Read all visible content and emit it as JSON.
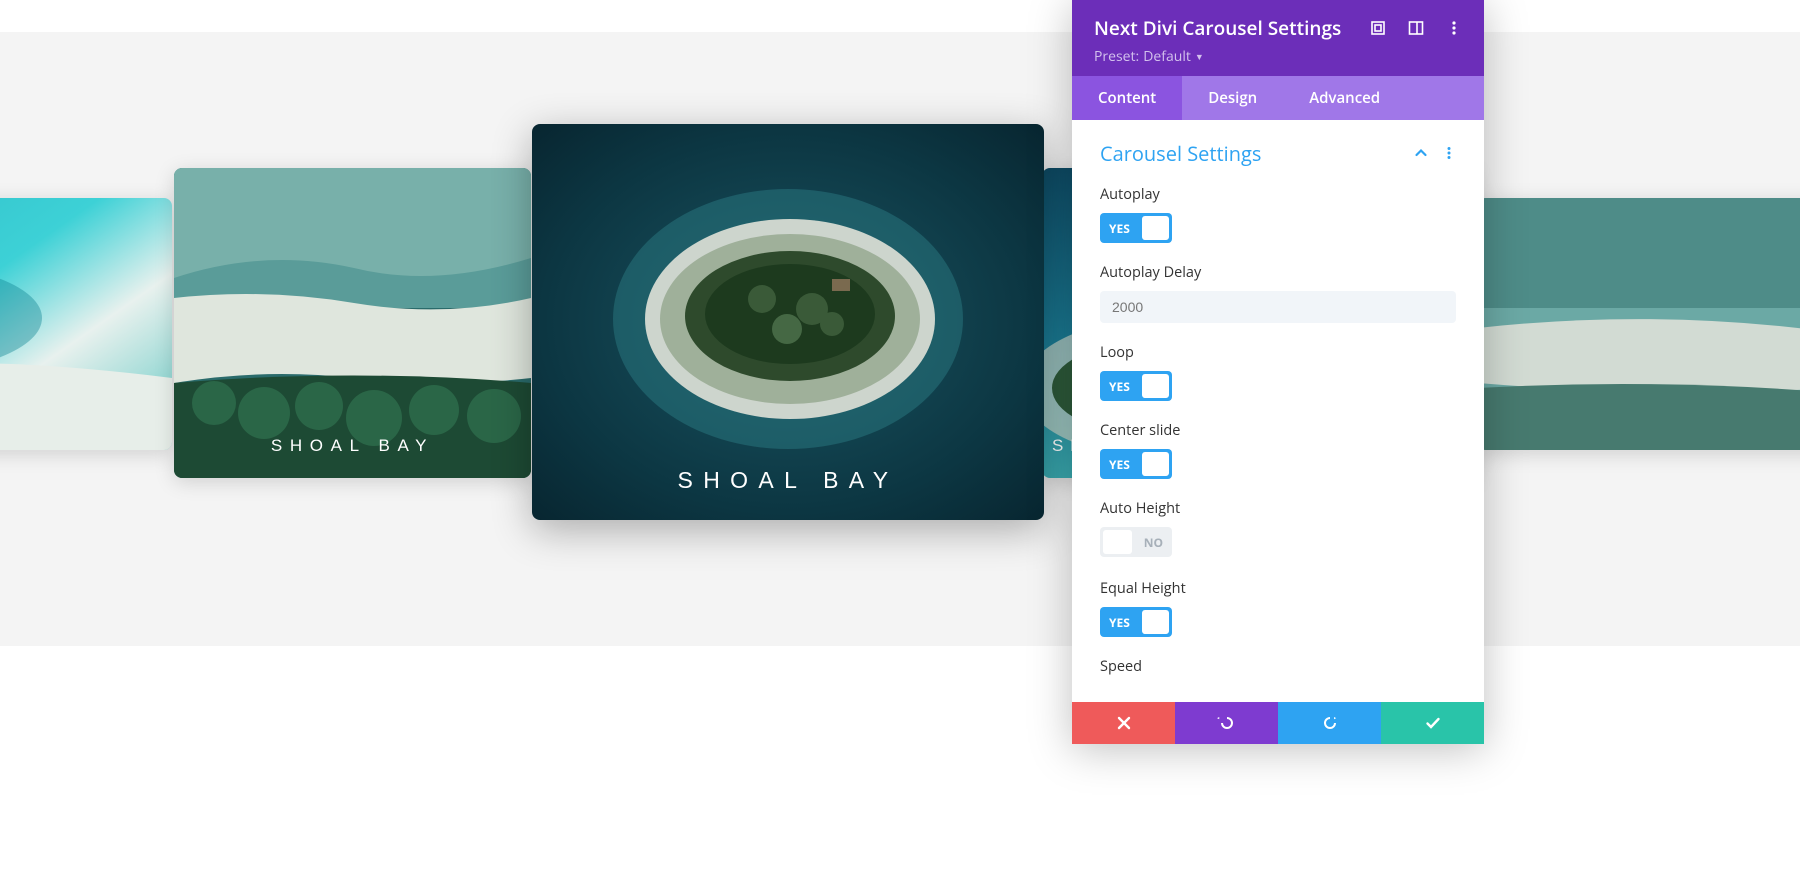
{
  "carousel": {
    "slides": [
      {
        "label": "SHOAL BAY"
      },
      {
        "label": "SHOAL BAY"
      },
      {
        "label": "SHOAL BAY"
      },
      {
        "label": "SH"
      },
      {
        "label": ""
      }
    ]
  },
  "panel": {
    "title": "Next Divi Carousel Settings",
    "preset_label": "Preset:",
    "preset_value": "Default",
    "tabs": {
      "content": "Content",
      "design": "Design",
      "advanced": "Advanced"
    },
    "section_title": "Carousel Settings",
    "fields": {
      "autoplay": {
        "label": "Autoplay",
        "value_text": "YES"
      },
      "autoplay_delay": {
        "label": "Autoplay Delay",
        "value": "2000"
      },
      "loop": {
        "label": "Loop",
        "value_text": "YES"
      },
      "center_slide": {
        "label": "Center slide",
        "value_text": "YES"
      },
      "auto_height": {
        "label": "Auto Height",
        "value_text": "NO"
      },
      "equal_height": {
        "label": "Equal Height",
        "value_text": "YES"
      },
      "speed": {
        "label": "Speed"
      }
    }
  }
}
